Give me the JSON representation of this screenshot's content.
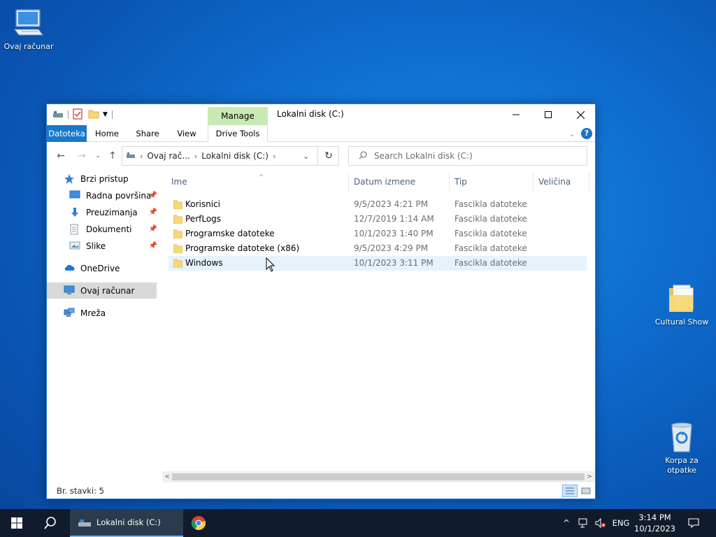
{
  "desktop": {
    "icons": [
      {
        "label": "Ovaj računar"
      },
      {
        "label": "Cultural Show"
      },
      {
        "label": "Korpa za otpatke"
      }
    ]
  },
  "window": {
    "title": "Lokalni disk (C:)",
    "contextual_tab": "Manage",
    "ribbon_tabs": [
      "Datoteka",
      "Home",
      "Share",
      "View",
      "Drive Tools"
    ],
    "address": {
      "crumbs": [
        "Ovaj rač...",
        "Lokalni disk (C:)"
      ]
    },
    "search_placeholder": "Search Lokalni disk (C:)",
    "nav": {
      "quick_access": "Brzi pristup",
      "pinned": [
        "Radna površina",
        "Preuzimanja",
        "Dokumenti",
        "Slike"
      ],
      "onedrive": "OneDrive",
      "this_pc": "Ovaj računar",
      "network": "Mreža"
    },
    "columns": [
      "Ime",
      "Datum izmene",
      "Tip",
      "Veličina"
    ],
    "files": [
      {
        "name": "Korisnici",
        "date": "9/5/2023 4:21 PM",
        "type": "Fascikla datoteke"
      },
      {
        "name": "PerfLogs",
        "date": "12/7/2019 1:14 AM",
        "type": "Fascikla datoteke"
      },
      {
        "name": "Programske datoteke",
        "date": "10/1/2023 1:40 PM",
        "type": "Fascikla datoteke"
      },
      {
        "name": "Programske datoteke (x86)",
        "date": "9/5/2023 4:29 PM",
        "type": "Fascikla datoteke"
      },
      {
        "name": "Windows",
        "date": "10/1/2023 3:11 PM",
        "type": "Fascikla datoteke"
      }
    ],
    "status": "Br. stavki: 5"
  },
  "taskbar": {
    "active_window": "Lokalni disk (C:)",
    "language": "ENG",
    "time": "3:14 PM",
    "date": "10/1/2023"
  },
  "colors": {
    "accent": "#1979ca",
    "manage_tab": "#c9eab4",
    "folder": "#f8d775",
    "taskbar": "#101b2b"
  }
}
